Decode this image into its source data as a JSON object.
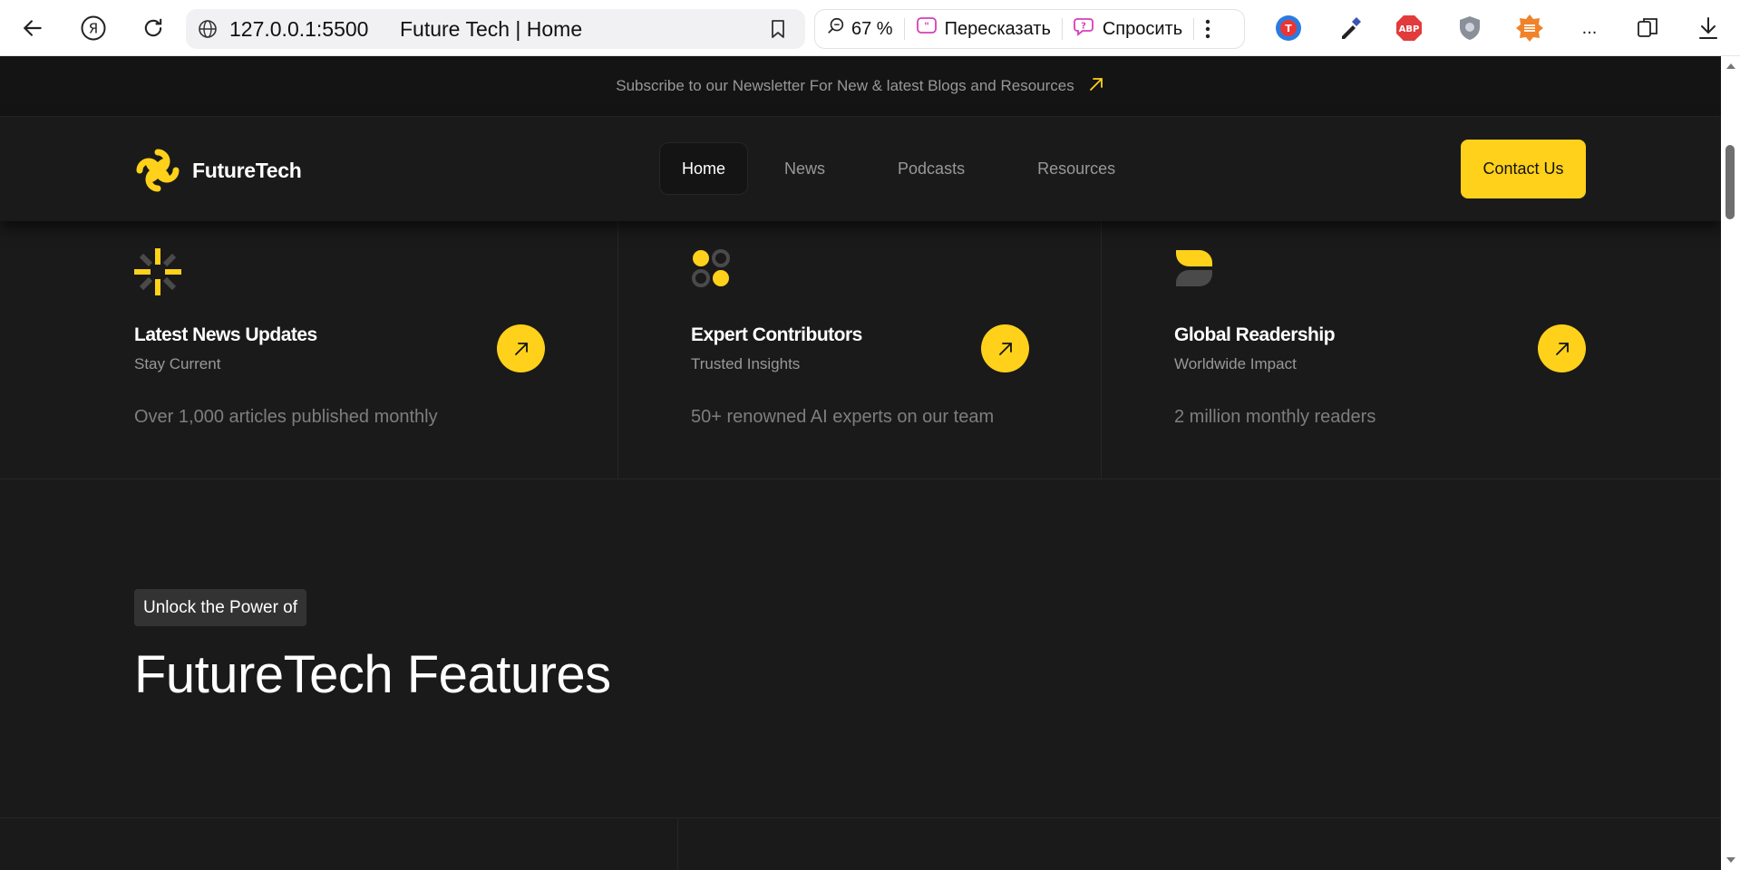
{
  "browser": {
    "url": "127.0.0.1:5500",
    "tab_title": "Future Tech | Home",
    "zoom": "67 %",
    "retell_label": "Пересказать",
    "ask_label": "Спросить",
    "ext_abp_label": "ABP",
    "more_label": "..."
  },
  "banner": {
    "text": "Subscribe to our Newsletter For New & latest Blogs and Resources"
  },
  "header": {
    "logo_text": "FutureTech",
    "nav": [
      "Home",
      "News",
      "Podcasts",
      "Resources"
    ],
    "active_nav": "Home",
    "contact_label": "Contact Us"
  },
  "stats": [
    {
      "title": "Latest News Updates",
      "subtitle": "Stay Current",
      "description": "Over 1,000 articles published monthly"
    },
    {
      "title": "Expert Contributors",
      "subtitle": "Trusted Insights",
      "description": "50+ renowned AI experts on our team"
    },
    {
      "title": "Global Readership",
      "subtitle": "Worldwide Impact",
      "description": "2 million monthly readers"
    }
  ],
  "features": {
    "tag": "Unlock the Power of",
    "heading": "FutureTech Features"
  },
  "colors": {
    "accent": "#ffd11a",
    "background": "#1a1a1a",
    "border": "#262626",
    "muted_text": "#98989a"
  }
}
